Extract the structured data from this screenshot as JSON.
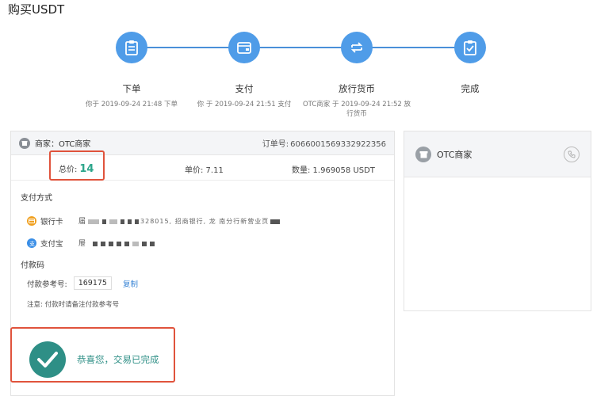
{
  "page": {
    "title": "购买USDT"
  },
  "steps": [
    {
      "label": "下单",
      "time": "你于 2019-09-24 21:48 下单",
      "icon": "clipboard-icon"
    },
    {
      "label": "支付",
      "time": "你 于 2019-09-24 21:51 支付",
      "icon": "wallet-icon"
    },
    {
      "label": "放行货币",
      "time": "OTC商家 于 2019-09-24 21:52 放行货币",
      "icon": "exchange-icon"
    },
    {
      "label": "完成",
      "time": "",
      "icon": "checklist-icon"
    }
  ],
  "order": {
    "merchant_label": "商家：OTC商家",
    "order_label": "订单号:",
    "order_no": "6066001569332922356",
    "total_label": "总价:",
    "total_value": "14",
    "price_label": "单价: 7.11",
    "qty_label": "数量: 1.969058 USDT"
  },
  "payment": {
    "section_title": "支付方式",
    "methods": [
      {
        "name": "银行卡",
        "detail_visible": "届",
        "mid": "328015, 招商银行, 龙 南分行新营业页",
        "icon": "bank-card-icon",
        "color": "#f0a020"
      },
      {
        "name": "支付宝",
        "detail_visible": "屉",
        "icon": "alipay-icon",
        "color": "#3a8ee6"
      }
    ],
    "ref_section_title": "付款码",
    "ref_label": "付款参考号:",
    "ref_value": "169175",
    "copy_label": "复制",
    "note": "注意: 付款时请备注付款参考号"
  },
  "success": {
    "text": "恭喜您，交易已完成"
  },
  "merchant_panel": {
    "name": "OTC商家"
  },
  "colors": {
    "accent": "#4f9ce8",
    "success": "#2e8f86",
    "highlight": "#e0533c"
  }
}
